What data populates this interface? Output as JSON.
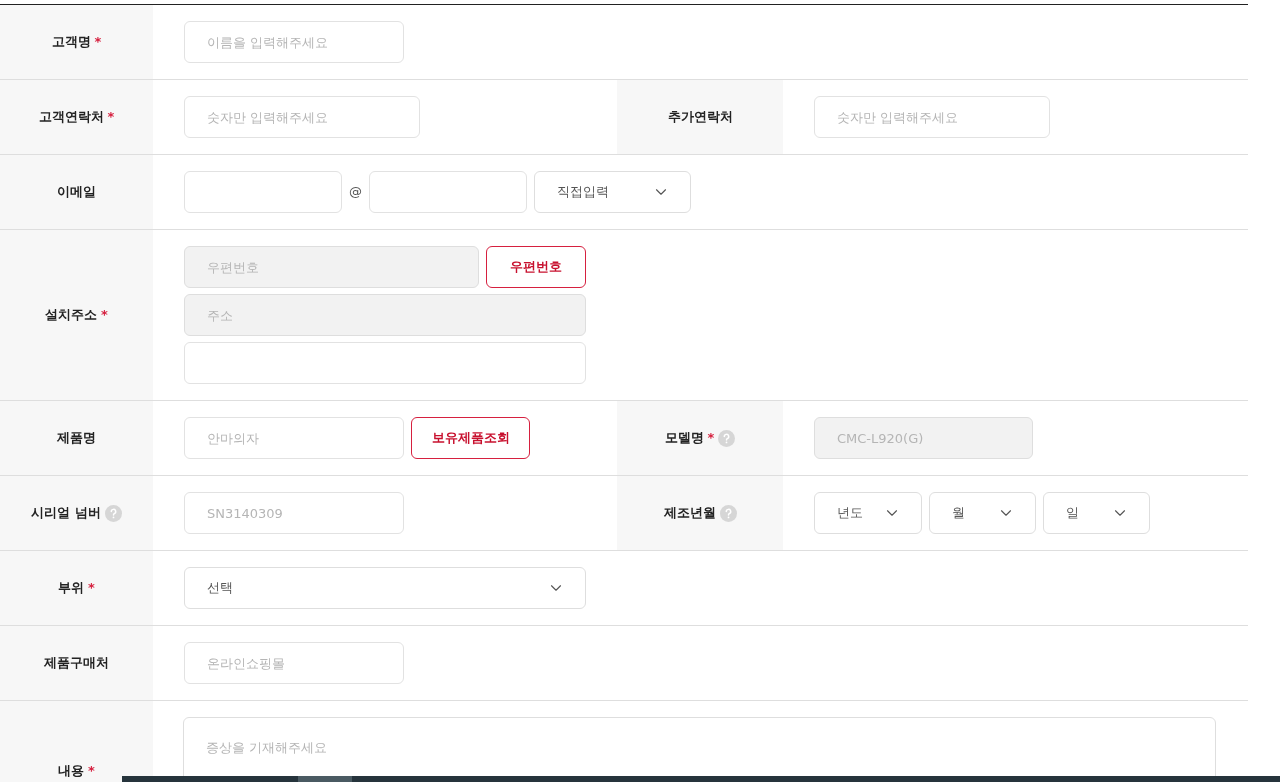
{
  "form": {
    "rows": [
      {
        "cells": [
          {
            "label": "고객명",
            "mark": "*",
            "help": false,
            "lines": [
              [
                {
                  "kind": "input",
                  "placeholder": "이름을 입력해주세요",
                  "disabled": false
                }
              ]
            ]
          }
        ]
      },
      {
        "cells": [
          {
            "label": "고객연락처",
            "mark": "*",
            "help": false,
            "lines": [
              [
                {
                  "kind": "input",
                  "placeholder": "숫자만 입력해주세요",
                  "disabled": false
                }
              ]
            ]
          },
          {
            "label": "추가연락처",
            "help": false,
            "lines": [
              [
                {
                  "kind": "input",
                  "placeholder": "숫자만 입력해주세요",
                  "disabled": false
                }
              ]
            ]
          }
        ]
      },
      {
        "cells": [
          {
            "label": "이메일",
            "help": false,
            "lines": [
              [
                {
                  "kind": "input",
                  "disabled": false
                },
                {
                  "kind": "text",
                  "text": "@"
                },
                {
                  "kind": "input",
                  "disabled": false
                },
                {
                  "kind": "select",
                  "value": "직접입력"
                }
              ]
            ]
          }
        ]
      },
      {
        "cells": [
          {
            "label": "설치주소",
            "mark": "*",
            "help": false,
            "lines": [
              [
                {
                  "kind": "input",
                  "placeholder": "우편번호",
                  "disabled": true
                },
                {
                  "kind": "button",
                  "label": "우편번호"
                }
              ],
              [
                {
                  "kind": "input",
                  "placeholder": "주소",
                  "disabled": true
                }
              ],
              [
                {
                  "kind": "input",
                  "disabled": false
                }
              ]
            ]
          }
        ]
      },
      {
        "cells": [
          {
            "label": "제품명",
            "help": false,
            "lines": [
              [
                {
                  "kind": "input",
                  "placeholder": "안마의자",
                  "disabled": false
                },
                {
                  "kind": "button",
                  "label": "보유제품조회"
                }
              ]
            ]
          },
          {
            "label": "모델명",
            "mark": "*",
            "help": true,
            "lines": [
              [
                {
                  "kind": "input",
                  "placeholder": "CMC-L920(G)",
                  "disabled": true
                }
              ]
            ]
          }
        ]
      },
      {
        "cells": [
          {
            "label": "시리얼 넘버",
            "help": true,
            "lines": [
              [
                {
                  "kind": "input",
                  "placeholder": "SN3140309",
                  "disabled": false
                }
              ]
            ]
          },
          {
            "label": "제조년월",
            "help": true,
            "lines": [
              [
                {
                  "kind": "select",
                  "value": "년도"
                },
                {
                  "kind": "select",
                  "value": "월"
                },
                {
                  "kind": "select",
                  "value": "일"
                }
              ]
            ]
          }
        ]
      },
      {
        "cells": [
          {
            "label": "부위",
            "mark": "*",
            "help": false,
            "lines": [
              [
                {
                  "kind": "select",
                  "value": "선택"
                }
              ]
            ]
          }
        ]
      },
      {
        "cells": [
          {
            "label": "제품구매처",
            "help": false,
            "lines": [
              [
                {
                  "kind": "input",
                  "placeholder": "온라인쇼핑몰",
                  "disabled": false
                }
              ]
            ]
          }
        ]
      },
      {
        "cells": [
          {
            "label": "내용",
            "mark": "*",
            "help": false,
            "lines": [
              [
                {
                  "kind": "textarea",
                  "placeholder": "증상을 기재해주세요"
                }
              ]
            ]
          }
        ]
      }
    ]
  }
}
